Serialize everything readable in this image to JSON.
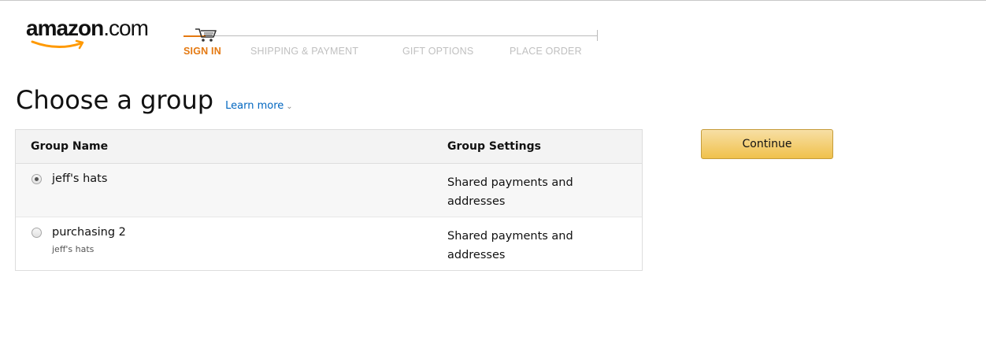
{
  "header": {
    "logo": {
      "text_main": "amazon",
      "text_suffix": ".com"
    },
    "steps": [
      {
        "label": "SIGN IN",
        "active": true
      },
      {
        "label": "SHIPPING & PAYMENT",
        "active": false
      },
      {
        "label": "GIFT OPTIONS",
        "active": false
      },
      {
        "label": "PLACE ORDER",
        "active": false
      }
    ],
    "cart_icon": "shopping-cart-icon"
  },
  "main": {
    "title": "Choose a group",
    "learn_more": "Learn more",
    "learn_more_icon": "chevron-down-icon",
    "table": {
      "columns": [
        "Group Name",
        "Group Settings"
      ],
      "rows": [
        {
          "name": "jeff's hats",
          "sub": "",
          "settings_line1": "Shared payments and",
          "settings_line2": "addresses",
          "selected": true
        },
        {
          "name": "purchasing 2",
          "sub": "jeff's hats",
          "settings_line1": "Shared payments and",
          "settings_line2": "addresses",
          "selected": false
        }
      ]
    },
    "continue_label": "Continue"
  },
  "colors": {
    "accent_orange": "#e47911",
    "link_blue": "#0066c0",
    "button_yellow": "#f0c14b"
  }
}
